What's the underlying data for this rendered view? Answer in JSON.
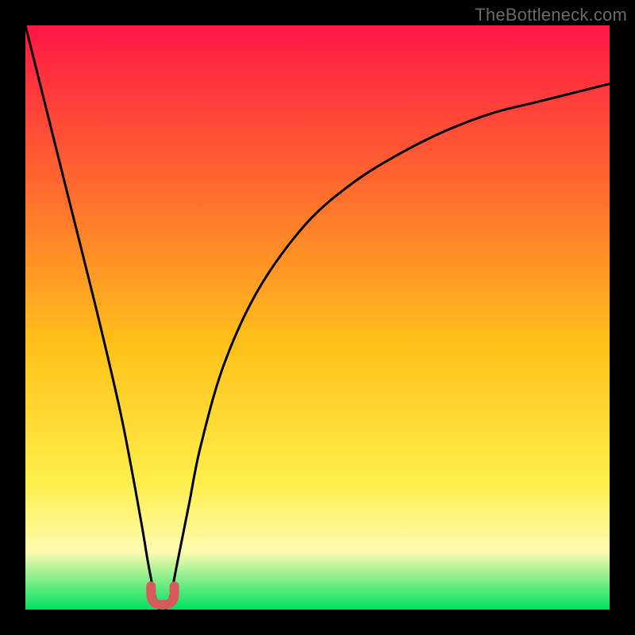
{
  "watermark": "TheBottleneck.com",
  "colors": {
    "frame": "#000000",
    "gradient_top": "#ff1745",
    "gradient_upper_mid": "#ff6b2e",
    "gradient_mid": "#ffc21a",
    "gradient_lower_mid": "#ffee4a",
    "gradient_band": "#fffbb0",
    "gradient_bottom": "#00e060",
    "curve": "#000000",
    "marker": "#d65a5a"
  },
  "chart_data": {
    "type": "line",
    "title": "",
    "xlabel": "",
    "ylabel": "",
    "xlim": [
      0,
      100
    ],
    "ylim": [
      0,
      100
    ],
    "grid": false,
    "series": [
      {
        "name": "bottleneck-curve",
        "x": [
          0,
          4,
          8,
          12,
          16,
          18,
          20,
          21,
          22,
          23,
          24,
          25,
          26,
          28,
          30,
          34,
          40,
          48,
          56,
          64,
          72,
          80,
          88,
          96,
          100
        ],
        "values": [
          100,
          84,
          68,
          52,
          35,
          25,
          14,
          8,
          3,
          0,
          0,
          3,
          8,
          18,
          28,
          42,
          55,
          66,
          73,
          78,
          82,
          85,
          87,
          89,
          90
        ]
      }
    ],
    "annotations": [
      {
        "name": "minimum-marker",
        "shape": "u",
        "x_range": [
          21.5,
          25.5
        ],
        "y_range": [
          0,
          4
        ]
      }
    ]
  }
}
